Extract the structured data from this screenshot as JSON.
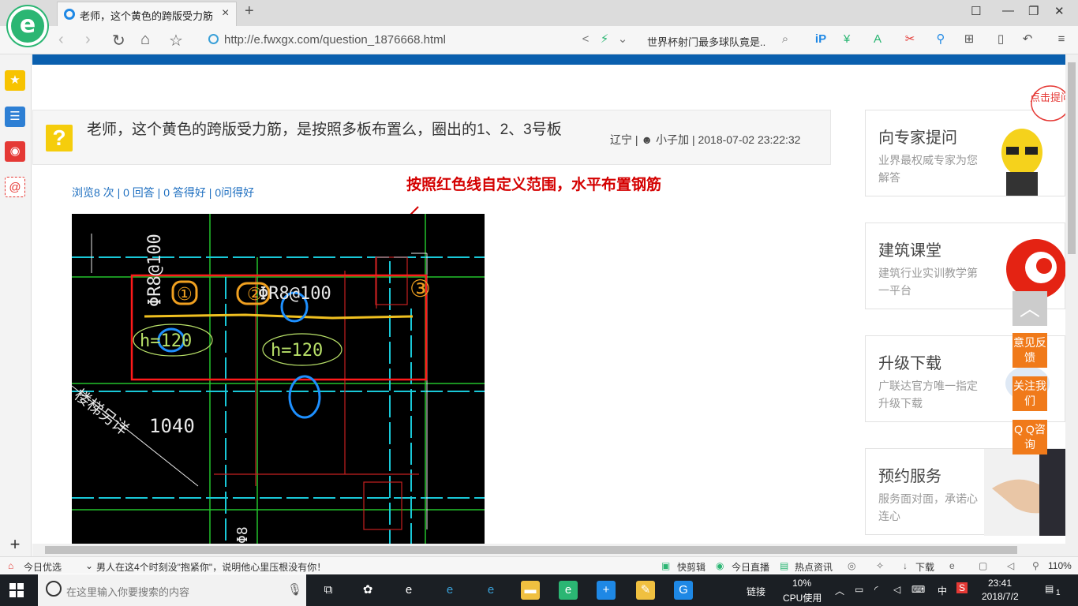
{
  "browser": {
    "tab_title": "老师，这个黄色的跨版受力筋，是按照多板布置么，圈出的1、2、3号板",
    "tab_close": "×",
    "new_tab": "+",
    "url": "http://e.fwxgx.com/question_1876668.html",
    "search_text": "世界杯射门最多球队竟是..",
    "nav": {
      "back": "‹",
      "forward": "›",
      "reload": "↻",
      "home": "⌂",
      "star": "☆"
    }
  },
  "question": {
    "title": "老师，这个黄色的跨版受力筋，是按照多板布置么，圈出的1、2、3号板",
    "region": "辽宁",
    "author": "小子加",
    "datetime": "2018-07-02 23:22:32",
    "stats": {
      "views": "浏览8 次",
      "answers": "0 回答",
      "good_answers": "0 答得好",
      "good_questions": "0问得好"
    },
    "annotation": "按照红色线自定义范围，水平布置钢筋"
  },
  "cad_drawing": {
    "labels": {
      "rebar_vertical": "ΦR8@100",
      "rebar_horizontal": "ΦR8@100",
      "h1": "h=120",
      "h2": "h=120",
      "dim": "1040",
      "stair_note": "楼梯另详",
      "bottom_label": "Φ8"
    },
    "handwritten": [
      "①",
      "②",
      "③"
    ]
  },
  "sidebar_cards": [
    {
      "title": "向专家提问",
      "subtitle": "业界最权威专家为您解答"
    },
    {
      "title": "建筑课堂",
      "subtitle": "建筑行业实训教学第一平台"
    },
    {
      "title": "升级下载",
      "subtitle": "广联达官方唯一指定升级下载"
    },
    {
      "title": "预约服务",
      "subtitle": "服务面对面，承诺心连心"
    }
  ],
  "floating": {
    "back_top": "︿",
    "feedback": "意见反馈",
    "follow": "关注我们",
    "qq": "Q Q咨询",
    "bubble": "点击提问"
  },
  "status_bar": {
    "today_pick": "今日优选",
    "news": "男人在这4个时刻没\"抱紧你\"，说明他心里压根没有你！",
    "quick_edit": "快剪辑",
    "live": "今日直播",
    "hot_news": "热点资讯",
    "download": "下载",
    "zoom": "110%"
  },
  "taskbar": {
    "search_placeholder": "在这里输入你要搜索的内容",
    "link": "链接",
    "cpu_percent": "10%",
    "cpu_label": "CPU使用",
    "ime": "中",
    "time": "23:41",
    "date": "2018/7/2",
    "notifications": "1"
  },
  "colors": {
    "accent_blue": "#0a5fae",
    "annotation_red": "#d40000",
    "float_orange": "#f07a1a",
    "question_yellow": "#f5cd0c"
  }
}
